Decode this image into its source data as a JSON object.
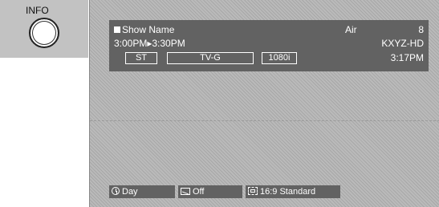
{
  "remote": {
    "button_label": "INFO"
  },
  "banner": {
    "show_name": "Show Name",
    "air_label": "Air",
    "channel_number": "8",
    "time_range": "3:00PM▸3:30PM",
    "station": "KXYZ-HD",
    "current_time": "3:17PM",
    "tags": {
      "st": "ST",
      "rating": "TV-G",
      "resolution": "1080i"
    }
  },
  "status_bar": {
    "sleep": {
      "icon": "clock-icon",
      "label": "Day"
    },
    "caption": {
      "icon": "caption-icon",
      "label": "Off"
    },
    "aspect": {
      "icon": "aspect-ratio-icon",
      "label": "16:9 Standard"
    }
  }
}
